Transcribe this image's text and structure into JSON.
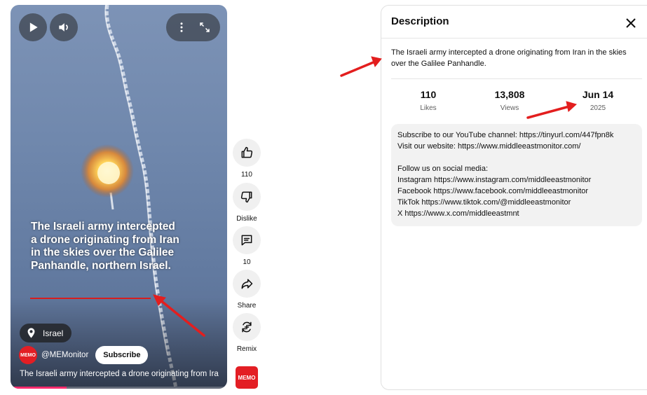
{
  "video": {
    "overlay_text": "The Israeli army intercepted a drone originating from Iran in the skies over the Galilee Panhandle, northern Israel.",
    "location": "Israel",
    "avatar_text": "MEMO",
    "channel_handle": "@MEMonitor",
    "subscribe_label": "Subscribe",
    "caption": "The Israeli army intercepted a drone originating from Iran in the skies over the Galilee Panhandle.",
    "progress_fraction": 0.26,
    "icons": [
      "play-icon",
      "volume-icon",
      "more-vert-icon",
      "fullscreen-icon",
      "location-pin-icon"
    ]
  },
  "actions": [
    {
      "name": "like",
      "label": "110",
      "icon": "thumbs-up-icon"
    },
    {
      "name": "dislike",
      "label": "Dislike",
      "icon": "thumbs-down-icon"
    },
    {
      "name": "comments",
      "label": "10",
      "icon": "comment-icon"
    },
    {
      "name": "share",
      "label": "Share",
      "icon": "share-icon"
    },
    {
      "name": "remix",
      "label": "Remix",
      "icon": "remix-icon"
    }
  ],
  "mini_logo_text": "MEMO",
  "description": {
    "title": "Description",
    "text": "The Israeli army intercepted a drone originating from Iran in the skies over the Galilee Panhandle.",
    "stats": [
      {
        "value": "110",
        "label": "Likes"
      },
      {
        "value": "13,808",
        "label": "Views"
      },
      {
        "value": "Jun 14",
        "label": "2025"
      }
    ],
    "links": {
      "youtube": "Subscribe to our YouTube channel: https://tinyurl.com/447fpn8k",
      "website": "Visit our website: https://www.middleeastmonitor.com/",
      "follow": "Follow us on social media:",
      "instagram": "Instagram https://www.instagram.com/middleeastmonitor",
      "facebook": "Facebook https://www.facebook.com/middleeastmonitor",
      "tiktok": "TikTok https://www.tiktok.com/@middleeastmonitor",
      "x": "X https://www.x.com/middleeastmnt"
    }
  },
  "colors": {
    "annotation_arrow": "#e31e1e",
    "overlay_underline": "#d61d1d",
    "brand_red": "#e31e24",
    "progress": "#ff2a6d"
  }
}
